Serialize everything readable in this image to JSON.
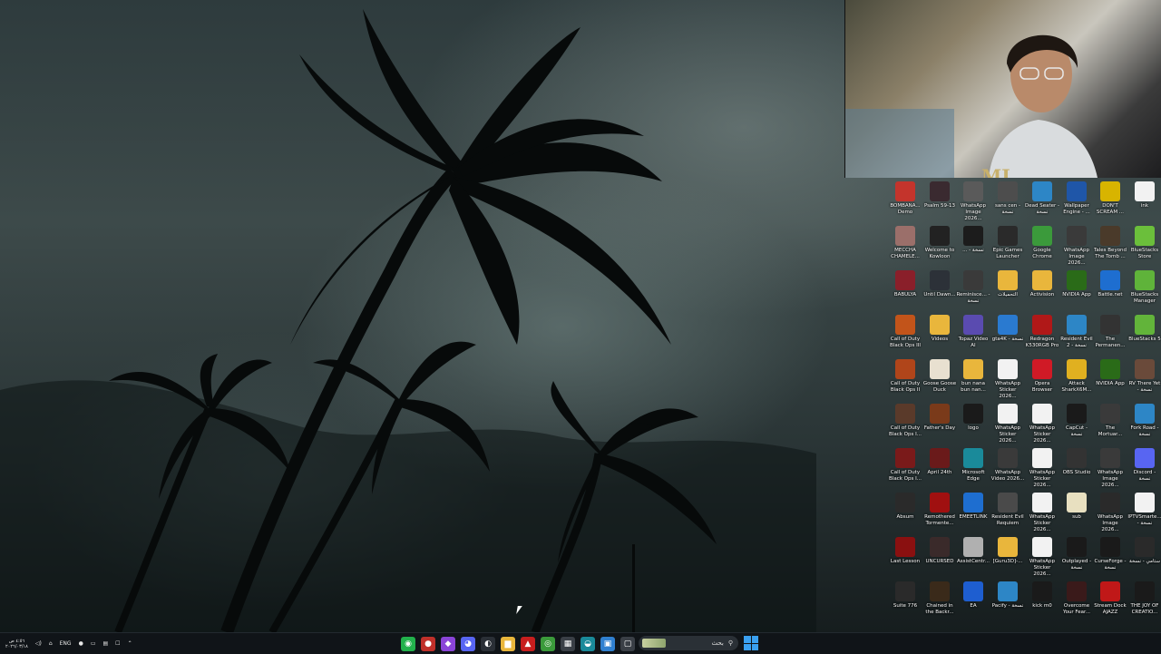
{
  "desktop": {
    "webcam_overlay": {
      "tag": "MJ"
    },
    "icons": [
      {
        "label": "BOMBANA... Demo",
        "icon": "game-icon",
        "color": "#c4342c"
      },
      {
        "label": "Psalm 59-13",
        "icon": "image-icon",
        "color": "#3a2a30"
      },
      {
        "label": "WhatsApp Image 2026...",
        "icon": "image-icon",
        "color": "#5a5a5a"
      },
      {
        "label": "sans cen - نسخة",
        "icon": "image-icon",
        "color": "#4d4d4d"
      },
      {
        "label": "Dead Seater - نسخة",
        "icon": "globe-icon",
        "color": "#2d86c6"
      },
      {
        "label": "Wallpaper Engine - ...",
        "icon": "wallpaper-icon",
        "color": "#1f56a8"
      },
      {
        "label": "DON'T SCREAM ...",
        "icon": "game-icon",
        "color": "#d8b400"
      },
      {
        "label": "ink",
        "icon": "file-icon",
        "color": "#f2f2f2"
      },
      {
        "label": "MECCHA CHAMELE...",
        "icon": "game-icon",
        "color": "#9b6f6a"
      },
      {
        "label": "Welcome to Kowloon",
        "icon": "game-icon",
        "color": "#222222"
      },
      {
        "label": "... - نسخة",
        "icon": "game-icon",
        "color": "#1c1c1c"
      },
      {
        "label": "Epic Games Launcher",
        "icon": "epic-icon",
        "color": "#2a2a2a"
      },
      {
        "label": "Google Chrome",
        "icon": "chrome-icon",
        "color": "#3b9a3b"
      },
      {
        "label": "WhatsApp Image 2026...",
        "icon": "image-icon",
        "color": "#3a3a3a"
      },
      {
        "label": "Tales Beyond The Tomb ...",
        "icon": "game-icon",
        "color": "#4a3a2a"
      },
      {
        "label": "BlueStacks Store",
        "icon": "bluestacks-icon",
        "color": "#6bbf3b"
      },
      {
        "label": "BABULYA",
        "icon": "game-icon",
        "color": "#8a1f2a"
      },
      {
        "label": "Until Dawn...",
        "icon": "game-icon",
        "color": "#2c3138"
      },
      {
        "label": "Reminisce... - نسخة",
        "icon": "game-icon",
        "color": "#3a3a3a"
      },
      {
        "label": "التحميلات",
        "icon": "folder-icon",
        "color": "#e9b63c"
      },
      {
        "label": "Activision",
        "icon": "folder-icon",
        "color": "#e9b63c"
      },
      {
        "label": "NVIDIA App",
        "icon": "nvidia-icon",
        "color": "#2a6b18"
      },
      {
        "label": "Battle.net",
        "icon": "battlenet-icon",
        "color": "#1e6ed0"
      },
      {
        "label": "BlueStacks Manager",
        "icon": "bluestacks-icon",
        "color": "#5fb33a"
      },
      {
        "label": "Call of Duty Black Ops III",
        "icon": "game-icon",
        "color": "#c2541a"
      },
      {
        "label": "Videos",
        "icon": "folder-icon",
        "color": "#e9b63c"
      },
      {
        "label": "Topaz Video AI",
        "icon": "topaz-icon",
        "color": "#5a4bb0"
      },
      {
        "label": "gta4K - نسخة",
        "icon": "file-icon",
        "color": "#2a7ad0"
      },
      {
        "label": "Redragon K530RGB Pro",
        "icon": "redragon-icon",
        "color": "#b01818"
      },
      {
        "label": "Resident Evil 2 - نسخة",
        "icon": "globe-icon",
        "color": "#2d86c6"
      },
      {
        "label": "The Permanen...",
        "icon": "game-icon",
        "color": "#333333"
      },
      {
        "label": "BlueStacks 5",
        "icon": "bluestacks-icon",
        "color": "#62b43a"
      },
      {
        "label": "Call of Duty Black Ops II",
        "icon": "game-icon",
        "color": "#b0451a"
      },
      {
        "label": "Goose Goose Duck",
        "icon": "game-icon",
        "color": "#e8e0d0"
      },
      {
        "label": "bun nana bun nan...",
        "icon": "folder-icon",
        "color": "#e9b63c"
      },
      {
        "label": "WhatsApp Sticker 2026...",
        "icon": "file-icon",
        "color": "#f2f2f2"
      },
      {
        "label": "Opera Browser",
        "icon": "opera-icon",
        "color": "#d01a26"
      },
      {
        "label": "Attack SharkX6M...",
        "icon": "game-icon",
        "color": "#e0b020"
      },
      {
        "label": "NVIDIA App",
        "icon": "nvidia-icon",
        "color": "#2a6b18"
      },
      {
        "label": "RV There Yet - نسخة",
        "icon": "game-icon",
        "color": "#6a4a3a"
      },
      {
        "label": "Call of Duty Black Ops I...",
        "icon": "game-icon",
        "color": "#5a3a2a"
      },
      {
        "label": "Father's Day",
        "icon": "game-icon",
        "color": "#7a3a1a"
      },
      {
        "label": "logo",
        "icon": "file-icon",
        "color": "#1a1a1a"
      },
      {
        "label": "WhatsApp Sticker 2026...",
        "icon": "file-icon",
        "color": "#f2f2f2"
      },
      {
        "label": "WhatsApp Sticker 2026...",
        "icon": "file-icon",
        "color": "#f2f2f2"
      },
      {
        "label": "CapCut - نسخة",
        "icon": "capcut-icon",
        "color": "#1a1a1a"
      },
      {
        "label": "The Mortuar...",
        "icon": "game-icon",
        "color": "#3a3a3a"
      },
      {
        "label": "Fork Road - نسخة",
        "icon": "globe-icon",
        "color": "#2d86c6"
      },
      {
        "label": "Call of Duty Black Ops I...",
        "icon": "game-icon",
        "color": "#7a1a1a"
      },
      {
        "label": "April 24th",
        "icon": "game-icon",
        "color": "#6a1a1a"
      },
      {
        "label": "Microsoft Edge",
        "icon": "edge-icon",
        "color": "#1a8a9a"
      },
      {
        "label": "WhatsApp Video 2026...",
        "icon": "video-icon",
        "color": "#3a3a3a"
      },
      {
        "label": "WhatsApp Sticker 2026...",
        "icon": "file-icon",
        "color": "#f2f2f2"
      },
      {
        "label": "OBS Studio",
        "icon": "obs-icon",
        "color": "#333333"
      },
      {
        "label": "WhatsApp Image 2026...",
        "icon": "image-icon",
        "color": "#3a3a3a"
      },
      {
        "label": "Discord - نسخة",
        "icon": "discord-icon",
        "color": "#5865f2"
      },
      {
        "label": "Absum",
        "icon": "game-icon",
        "color": "#2a2a2a"
      },
      {
        "label": "Remothered Tormente...",
        "icon": "game-icon",
        "color": "#a01010"
      },
      {
        "label": "EMEETLINK",
        "icon": "emeet-icon",
        "color": "#1e6ed0"
      },
      {
        "label": "Resident Evil Requiem",
        "icon": "game-icon",
        "color": "#4a4a4a"
      },
      {
        "label": "WhatsApp Sticker 2026...",
        "icon": "file-icon",
        "color": "#f2f2f2"
      },
      {
        "label": "sub",
        "icon": "file-icon",
        "color": "#e8e0c0"
      },
      {
        "label": "WhatsApp Image 2026...",
        "icon": "image-icon",
        "color": "#2a2a2a"
      },
      {
        "label": "IPTVSmarte... - نسخة",
        "icon": "file-icon",
        "color": "#f2f2f2"
      },
      {
        "label": "Last Lesson",
        "icon": "game-icon",
        "color": "#8a1010"
      },
      {
        "label": "UNCURSED",
        "icon": "game-icon",
        "color": "#3a2a2a"
      },
      {
        "label": "AssistCentr...",
        "icon": "assist-icon",
        "color": "#b0b0b0"
      },
      {
        "label": "[Guru3D]-...",
        "icon": "folder-icon",
        "color": "#e9b63c"
      },
      {
        "label": "WhatsApp Sticker 2026...",
        "icon": "file-icon",
        "color": "#f2f2f2"
      },
      {
        "label": "Outplayed - نسخة",
        "icon": "outplayed-icon",
        "color": "#1a1a1a"
      },
      {
        "label": "CurseForge - نسخة",
        "icon": "curseforge-icon",
        "color": "#1a1a1a"
      },
      {
        "label": "ستامي - نسخة",
        "icon": "file-icon",
        "color": "#2a2a2a"
      },
      {
        "label": "Suite 776",
        "icon": "game-icon",
        "color": "#2a2a2a"
      },
      {
        "label": "Chained in the Backr...",
        "icon": "game-icon",
        "color": "#3a2a1a"
      },
      {
        "label": "EA",
        "icon": "ea-icon",
        "color": "#1e5ed0"
      },
      {
        "label": "Pacify - نسخة",
        "icon": "globe-icon",
        "color": "#2d86c6"
      },
      {
        "label": "kick m0",
        "icon": "file-icon",
        "color": "#1a1a1a"
      },
      {
        "label": "Overcome Your Fear...",
        "icon": "game-icon",
        "color": "#3a1a1a"
      },
      {
        "label": "Stream Dock AJAZZ",
        "icon": "streamdock-icon",
        "color": "#c01818"
      },
      {
        "label": "THE JOY OF CREATIO...",
        "icon": "game-icon",
        "color": "#1a1a1a"
      }
    ]
  },
  "taskbar": {
    "clock_time": "٤:٥٦ ص",
    "clock_date": "٢٠٢٦/٠٣/١٨",
    "language": "ENG",
    "search_placeholder": "بحث",
    "apps": [
      {
        "name": "whatsapp-app",
        "color": "#22b14c",
        "glyph": "◉"
      },
      {
        "name": "recording-app",
        "color": "#c0302a",
        "glyph": "●"
      },
      {
        "name": "messenger-app",
        "color": "#8a44d8",
        "glyph": "◆"
      },
      {
        "name": "discord-app",
        "color": "#5865f2",
        "glyph": "◕"
      },
      {
        "name": "game-app",
        "color": "#2a2f36",
        "glyph": "◐"
      },
      {
        "name": "file-explorer-app",
        "color": "#e9b63c",
        "glyph": "▆"
      },
      {
        "name": "antivirus-app",
        "color": "#c81e1e",
        "glyph": "▲"
      },
      {
        "name": "chrome-app",
        "color": "#3b9a3b",
        "glyph": "◎"
      },
      {
        "name": "calendar-app",
        "color": "#3a3f46",
        "glyph": "▦"
      },
      {
        "name": "edge-app",
        "color": "#1a8a9a",
        "glyph": "◒"
      },
      {
        "name": "store-app",
        "color": "#3080d0",
        "glyph": "▣"
      },
      {
        "name": "window-app",
        "color": "#3a3f46",
        "glyph": "▢"
      }
    ]
  }
}
